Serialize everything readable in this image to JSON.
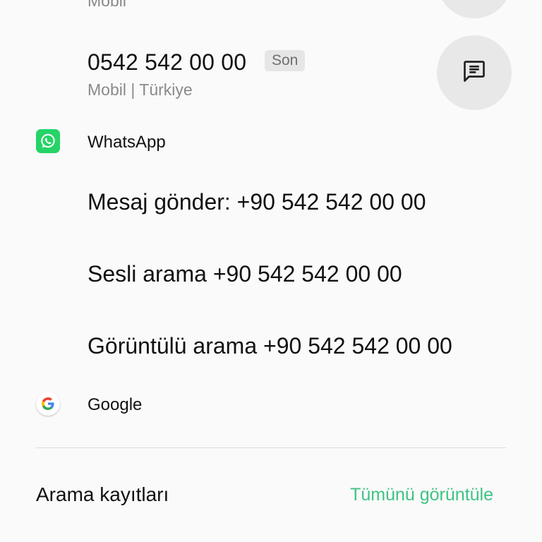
{
  "previous_entry": {
    "type_label": "Mobil"
  },
  "phone": {
    "number": "0542 542 00 00",
    "badge": "Son",
    "meta": "Mobil | Türkiye",
    "action_icon": "message-icon"
  },
  "whatsapp": {
    "app_name": "WhatsApp",
    "icon": "whatsapp-icon",
    "icon_color": "#25d366",
    "actions": [
      {
        "label": "Mesaj gönder: +90 542 542 00 00"
      },
      {
        "label": "Sesli arama +90 542 542 00 00"
      },
      {
        "label": "Görüntülü arama +90 542 542 00 00"
      }
    ]
  },
  "google": {
    "app_name": "Google",
    "icon": "google-icon"
  },
  "call_log": {
    "title": "Arama kayıtları",
    "view_all": "Tümünü görüntüle",
    "link_color": "#3fc384"
  }
}
